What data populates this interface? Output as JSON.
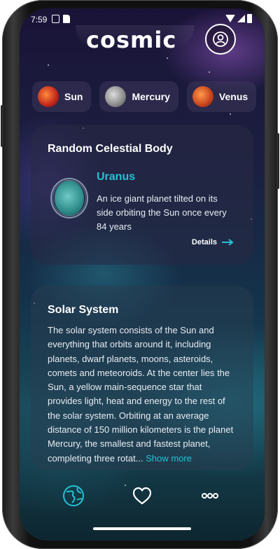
{
  "status_bar": {
    "time": "7:59"
  },
  "header": {
    "logo_text": "cosmic",
    "profile_icon": "user-circle-icon"
  },
  "bodies_strip": [
    {
      "name": "Sun",
      "color": "#d63a1e"
    },
    {
      "name": "Mercury",
      "color": "#9a9a9a"
    },
    {
      "name": "Venus",
      "color": "#d2531f"
    }
  ],
  "random_card": {
    "title": "Random Celestial Body",
    "body_name": "Uranus",
    "description": "An ice giant planet tilted on its side orbiting the Sun once every 84 years",
    "details_label": "Details"
  },
  "solar_card": {
    "title": "Solar System",
    "text": "The solar system consists of the Sun and everything that orbits around it, including planets, dwarf planets, moons, asteroids, comets and meteoroids. At the center lies the Sun, a yellow main-sequence star that provides light, heat and energy to the rest of the solar system. Orbiting at an average distance of 150 million kilometers is the planet Mercury, the smallest and fastest planet, completing three rotat...",
    "show_more_label": " Show more"
  },
  "bottom_nav": {
    "items": [
      {
        "icon": "globe-icon",
        "active": true
      },
      {
        "icon": "heart-icon",
        "active": false
      },
      {
        "icon": "more-icon",
        "active": false
      }
    ]
  },
  "colors": {
    "accent": "#22c2d6",
    "card_bg": "#282a46"
  }
}
